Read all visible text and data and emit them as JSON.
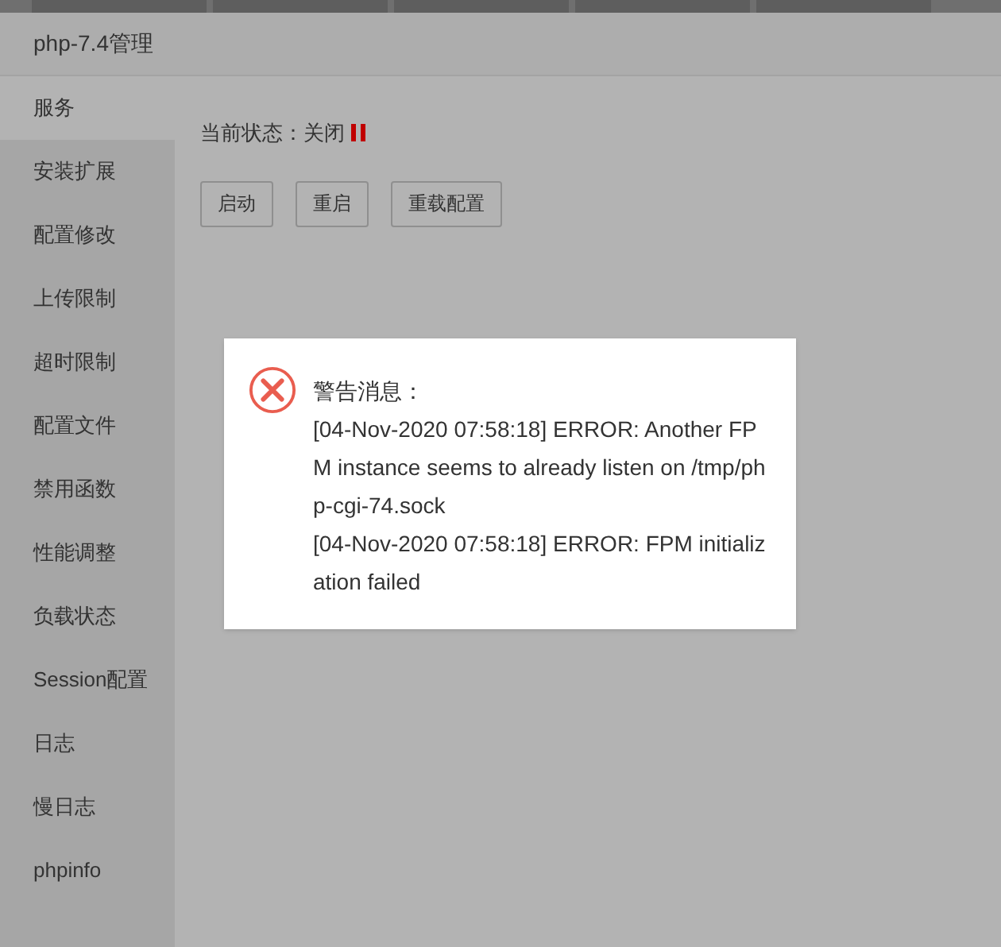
{
  "window": {
    "title": "php-7.4管理"
  },
  "sidebar": {
    "items": [
      {
        "label": "服务",
        "selected": true
      },
      {
        "label": "安装扩展",
        "selected": false
      },
      {
        "label": "配置修改",
        "selected": false
      },
      {
        "label": "上传限制",
        "selected": false
      },
      {
        "label": "超时限制",
        "selected": false
      },
      {
        "label": "配置文件",
        "selected": false
      },
      {
        "label": "禁用函数",
        "selected": false
      },
      {
        "label": "性能调整",
        "selected": false
      },
      {
        "label": "负载状态",
        "selected": false
      },
      {
        "label": "Session配置",
        "selected": false
      },
      {
        "label": "日志",
        "selected": false
      },
      {
        "label": "慢日志",
        "selected": false
      },
      {
        "label": "phpinfo",
        "selected": false
      }
    ]
  },
  "status": {
    "label": "当前状态：关闭",
    "running": false
  },
  "buttons": [
    "启动",
    "重启",
    "重载配置"
  ],
  "alert": {
    "title": "警告消息：",
    "messages": [
      "[04-Nov-2020 07:58:18] ERROR: Another FPM instance seems to already listen on /tmp/php-cgi-74.sock",
      "[04-Nov-2020 07:58:18] ERROR: FPM initialization failed"
    ]
  }
}
